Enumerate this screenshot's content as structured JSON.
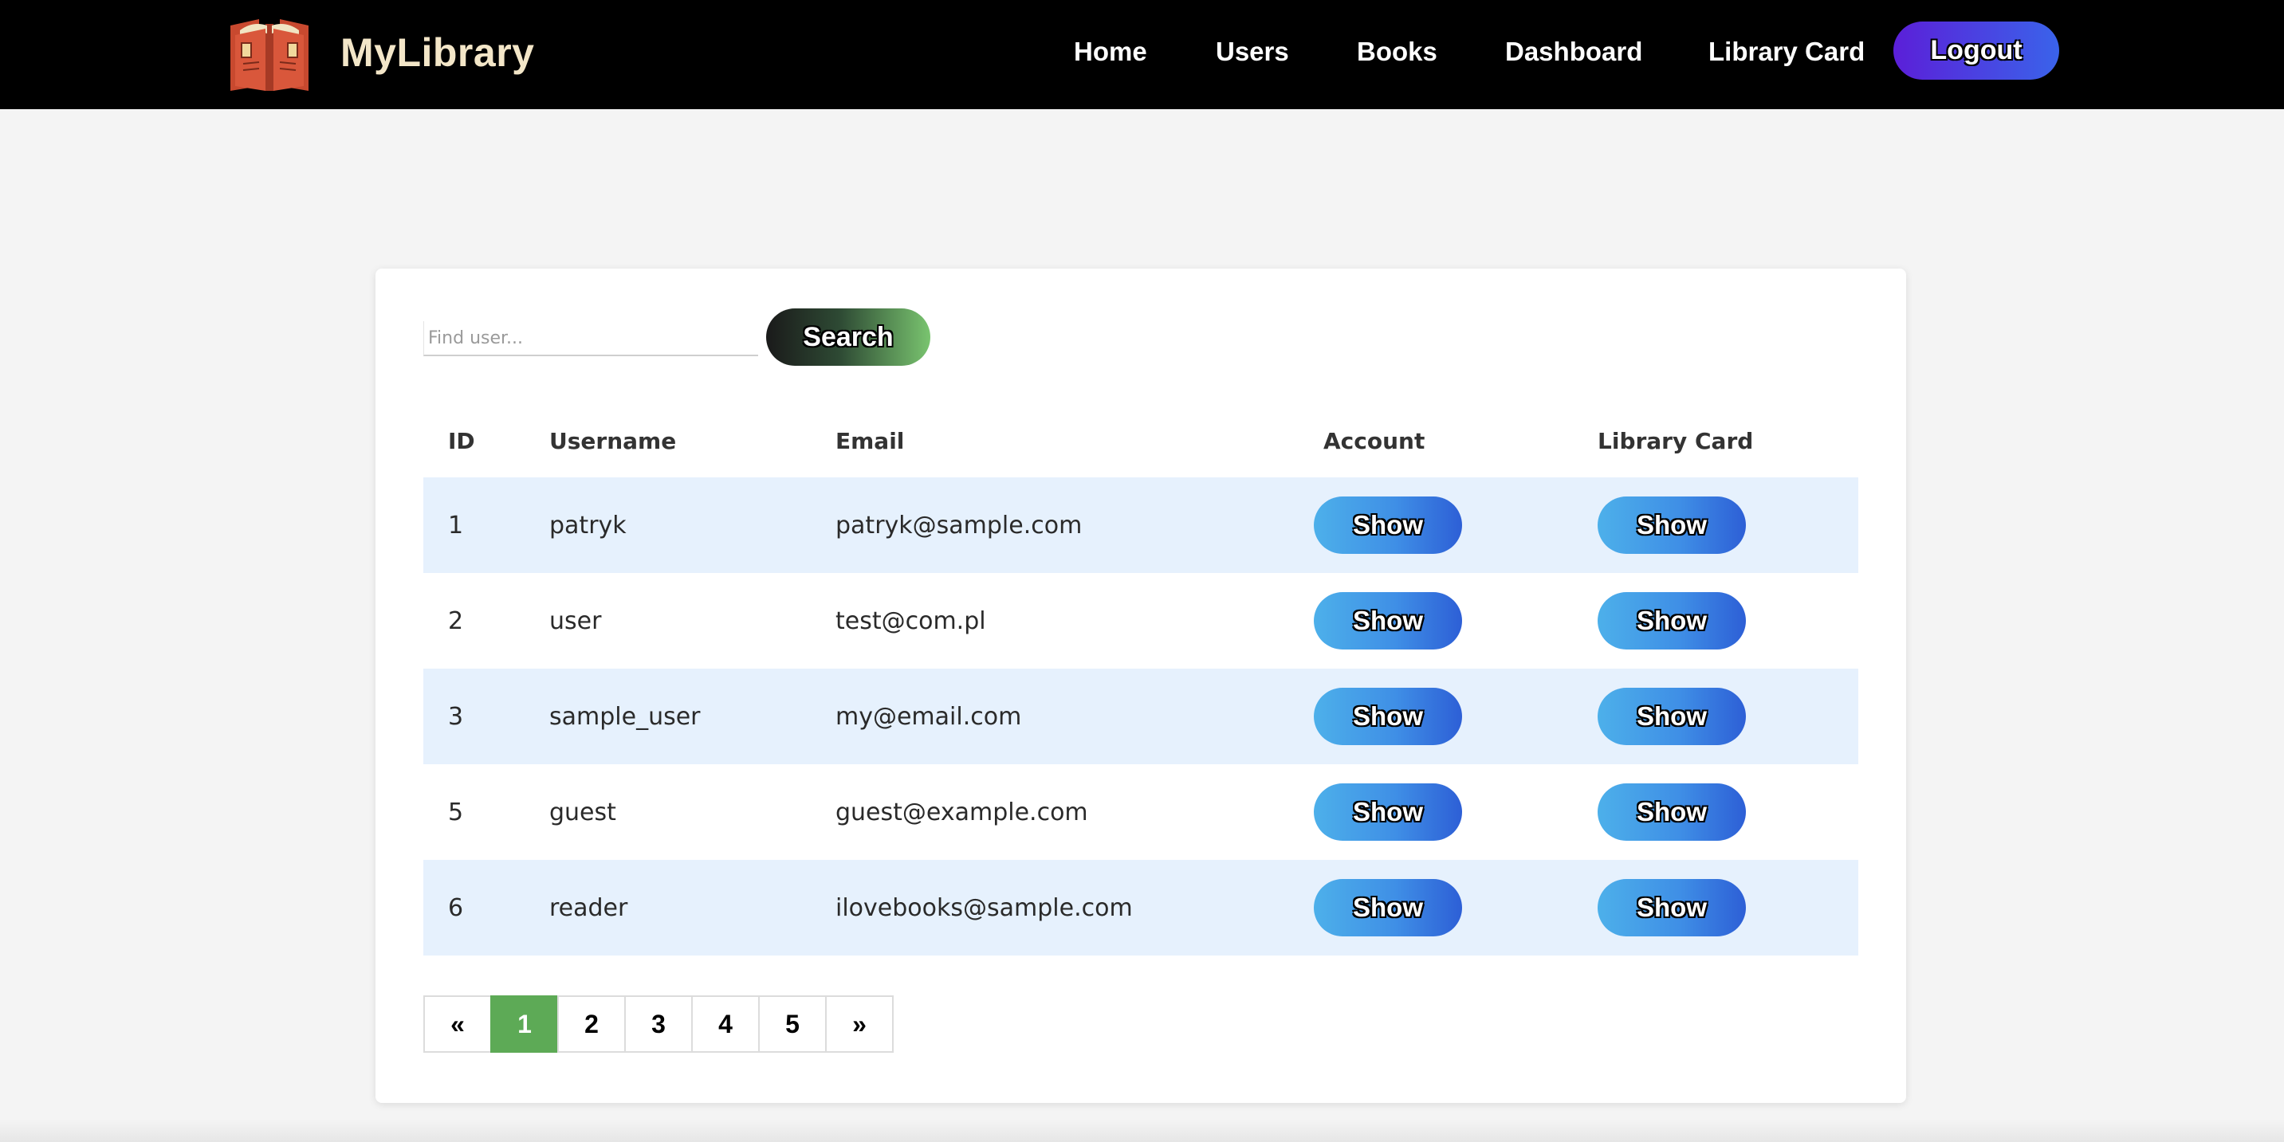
{
  "app": {
    "title": "MyLibrary"
  },
  "nav": {
    "links": [
      "Home",
      "Users",
      "Books",
      "Dashboard",
      "Library Card"
    ],
    "logout_label": "Logout"
  },
  "search": {
    "placeholder": "Find user...",
    "value": "",
    "button_label": "Search"
  },
  "table": {
    "headers": [
      "ID",
      "Username",
      "Email",
      "Account",
      "Library Card"
    ],
    "rows": [
      {
        "id": "1",
        "username": "patryk",
        "email": "patryk@sample.com",
        "account_action": "Show",
        "card_action": "Show"
      },
      {
        "id": "2",
        "username": "user",
        "email": "test@com.pl",
        "account_action": "Show",
        "card_action": "Show"
      },
      {
        "id": "3",
        "username": "sample_user",
        "email": "my@email.com",
        "account_action": "Show",
        "card_action": "Show"
      },
      {
        "id": "5",
        "username": "guest",
        "email": "guest@example.com",
        "account_action": "Show",
        "card_action": "Show"
      },
      {
        "id": "6",
        "username": "reader",
        "email": "ilovebooks@sample.com",
        "account_action": "Show",
        "card_action": "Show"
      }
    ]
  },
  "pagination": {
    "prev_label": "«",
    "pages": [
      "1",
      "2",
      "3",
      "4",
      "5"
    ],
    "next_label": "»",
    "current_page": "1"
  },
  "icons": {
    "logo": "open-book-icon"
  },
  "colors": {
    "navbar_bg": "#000000",
    "brand_text": "#f3e6c8",
    "logout_gradient": [
      "#5b1fd8",
      "#3a63ea"
    ],
    "search_gradient": [
      "#1a1a1a",
      "#79c46f"
    ],
    "show_gradient": [
      "#4db0ea",
      "#2d5fd6"
    ],
    "row_highlight": "#e6f1fd",
    "active_page": "#5daa56",
    "page_bg": "#f4f4f4"
  }
}
